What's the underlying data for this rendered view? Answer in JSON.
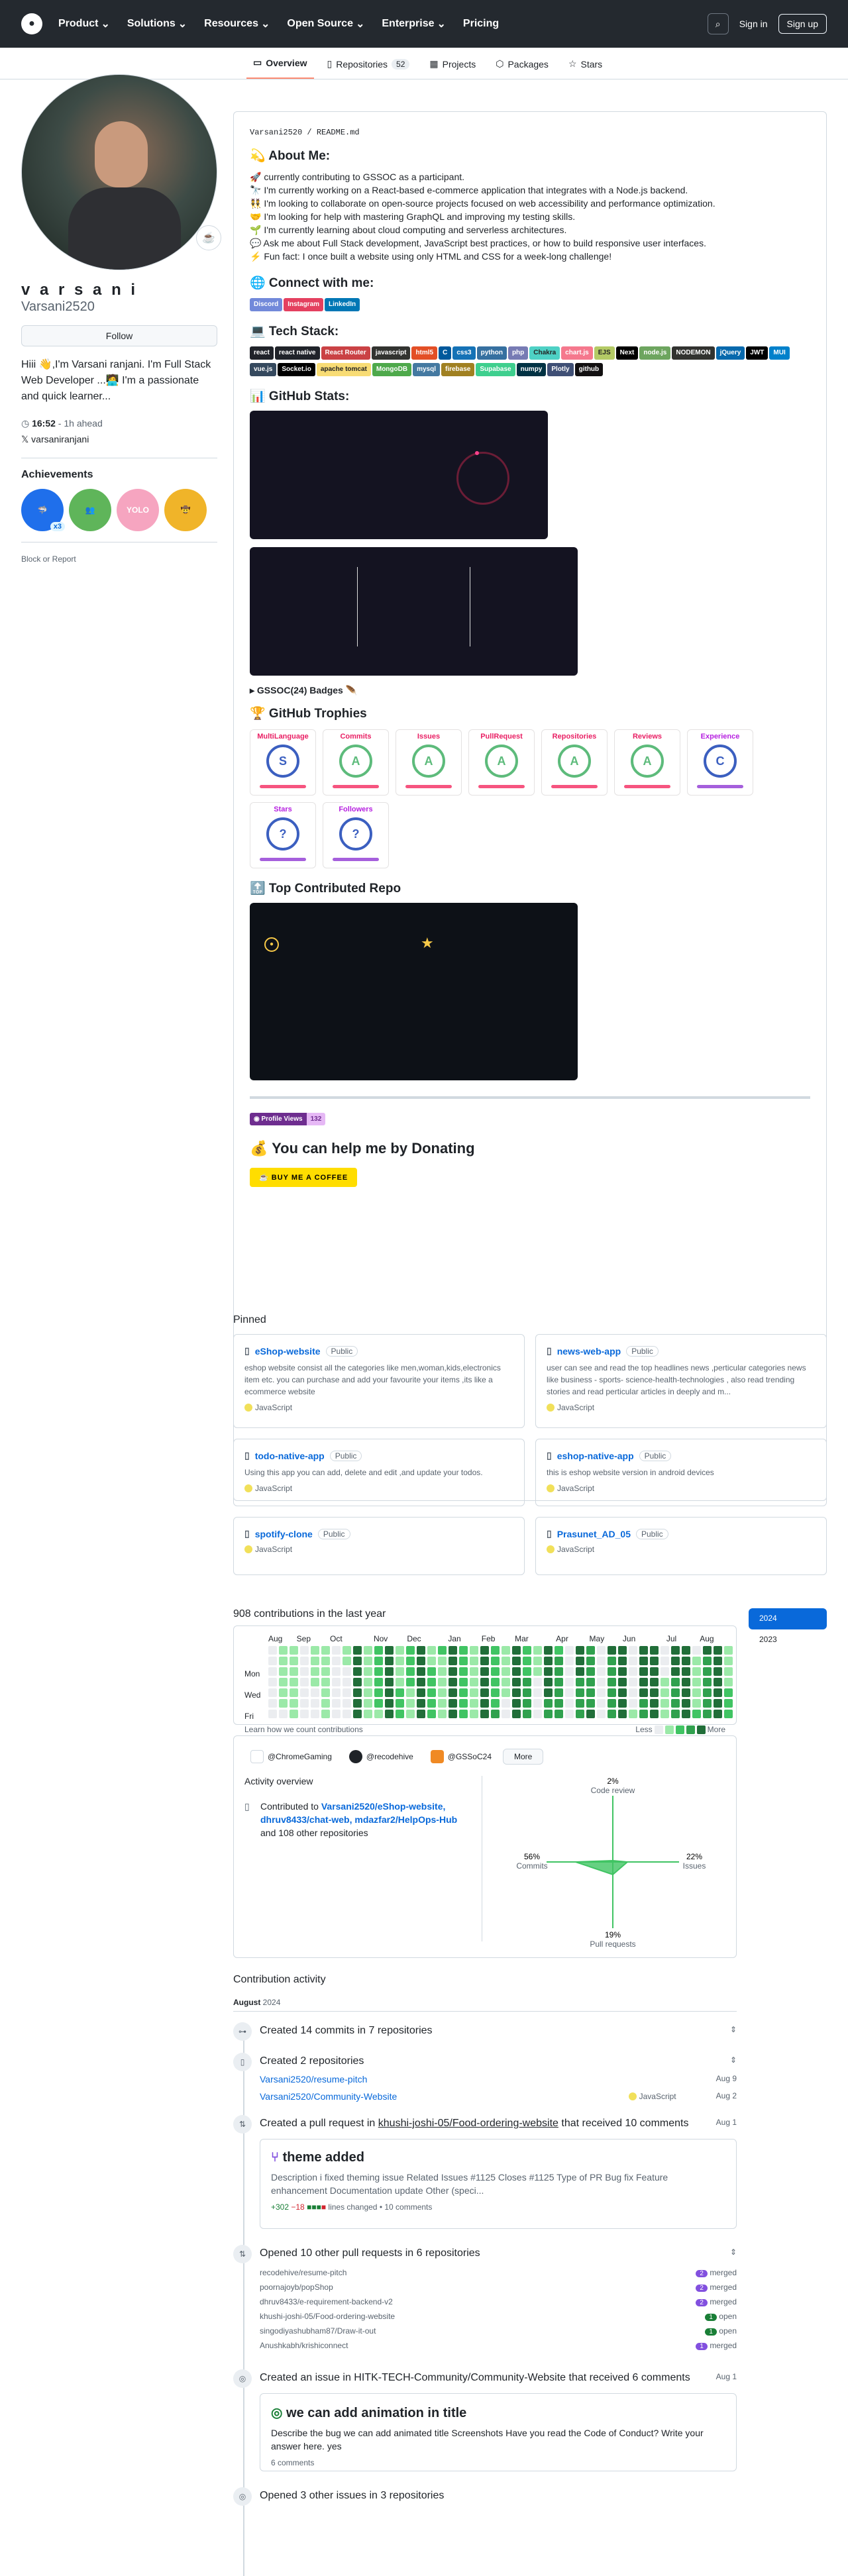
{
  "header": {
    "nav": [
      "Product",
      "Solutions",
      "Resources",
      "Open Source",
      "Enterprise",
      "Pricing"
    ],
    "signin": "Sign in",
    "signup": "Sign up"
  },
  "tabs": [
    {
      "label": "Overview"
    },
    {
      "label": "Repositories",
      "count": "52"
    },
    {
      "label": "Projects"
    },
    {
      "label": "Packages"
    },
    {
      "label": "Stars"
    }
  ],
  "profile": {
    "name": "v a r s a n i",
    "login": "Varsani2520",
    "follow": "Follow",
    "bio": "Hiii 👋,I'm Varsani ranjani. I'm Full Stack Web Developer ...🧑‍💻 I'm a passionate and quick learner...",
    "time": "16:52",
    "ahead": " - 1h ahead",
    "x": "varsaniranjani",
    "ach_title": "Achievements",
    "ach_count": "x3",
    "report": "Block or Report"
  },
  "readme": {
    "path": "Varsani2520 / README.md",
    "about": "💫 About Me:",
    "lines": [
      "🚀 currently contributing to GSSOC as a participant.",
      "🔭 I'm currently working on a React-based e-commerce application that integrates with a Node.js backend.",
      "👯 I'm looking to collaborate on open-source projects focused on web accessibility and performance optimization.",
      "🤝 I'm looking for help with mastering GraphQL and improving my testing skills.",
      "🌱 I'm currently learning about cloud computing and serverless architectures.",
      "💬 Ask me about Full Stack development, JavaScript best practices, or how to build responsive user interfaces.",
      "⚡ Fun fact: I once built a website using only HTML and CSS for a week-long challenge!"
    ],
    "connect": "🌐 Connect with me:",
    "socials": [
      {
        "t": "Discord",
        "c": "#7289da"
      },
      {
        "t": "Instagram",
        "c": "#e4405f"
      },
      {
        "t": "LinkedIn",
        "c": "#0077b5"
      }
    ],
    "tech": "💻 Tech Stack:",
    "stack": [
      {
        "t": "react",
        "c": "#20232a"
      },
      {
        "t": "react native",
        "c": "#20232a"
      },
      {
        "t": "React Router",
        "c": "#ca4245"
      },
      {
        "t": "javascript",
        "c": "#323330"
      },
      {
        "t": "html5",
        "c": "#e34f26"
      },
      {
        "t": "C",
        "c": "#00599c"
      },
      {
        "t": "css3",
        "c": "#1572b6"
      },
      {
        "t": "python",
        "c": "#3670a0"
      },
      {
        "t": "php",
        "c": "#777bb4"
      },
      {
        "t": "Chakra",
        "c": "#4ed1c5"
      },
      {
        "t": "chart.js",
        "c": "#f5788d"
      },
      {
        "t": "EJS",
        "c": "#b4ca65"
      },
      {
        "t": "Next",
        "c": "#000000"
      },
      {
        "t": "node.js",
        "c": "#6da55f"
      },
      {
        "t": "NODEMON",
        "c": "#323330"
      },
      {
        "t": "jQuery",
        "c": "#0769ad"
      },
      {
        "t": "JWT",
        "c": "#000000"
      },
      {
        "t": "MUI",
        "c": "#0081cb"
      },
      {
        "t": "vue.js",
        "c": "#35495e"
      },
      {
        "t": "Socket.io",
        "c": "#000000"
      },
      {
        "t": "apache tomcat",
        "c": "#f8dc75"
      },
      {
        "t": "MongoDB",
        "c": "#4ea94b"
      },
      {
        "t": "mysql",
        "c": "#4479a1"
      },
      {
        "t": "firebase",
        "c": "#a08021"
      },
      {
        "t": "Supabase",
        "c": "#3ecf8e"
      },
      {
        "t": "numpy",
        "c": "#013243"
      },
      {
        "t": "Plotly",
        "c": "#3f4f75"
      },
      {
        "t": "github",
        "c": "#121011"
      }
    ],
    "stats": "📊 GitHub Stats:",
    "gssoc": "▸ GSSOC(24) Badges 🪶",
    "trophies_title": "🏆 GitHub Trophies",
    "trophies": [
      {
        "t": "MultiLanguage",
        "g": "S"
      },
      {
        "t": "Commits",
        "g": "A"
      },
      {
        "t": "Issues",
        "g": "A"
      },
      {
        "t": "PullRequest",
        "g": "A"
      },
      {
        "t": "Repositories",
        "g": "A"
      },
      {
        "t": "Reviews",
        "g": "A"
      },
      {
        "t": "Experience",
        "g": "C"
      },
      {
        "t": "Stars",
        "g": "?"
      },
      {
        "t": "Followers",
        "g": "?"
      }
    ],
    "top_repo": "🔝 Top Contributed Repo",
    "views_label": "Profile Views",
    "views": "132",
    "donate": "💰 You can help me by Donating",
    "coffee": "☕ BUY ME A COFFEE"
  },
  "pinned": {
    "title": "Pinned",
    "public": "Public",
    "repos": [
      {
        "name": "eShop-website",
        "desc": "eshop website consist all the categories like men,woman,kids,electronics item etc. you can purchase and add your favourite your items ,its like a ecommerce website",
        "lang": "JavaScript"
      },
      {
        "name": "news-web-app",
        "desc": "user can see and read the top headlines news ,perticular categories news like business - sports- science-health-technologies , also read trending stories and read perticular articles in deeply and m...",
        "lang": "JavaScript"
      },
      {
        "name": "todo-native-app",
        "desc": "Using this app you can add, delete and edit ,and update your todos.",
        "lang": "JavaScript"
      },
      {
        "name": "eshop-native-app",
        "desc": "this is eshop website version in android devices",
        "lang": "JavaScript"
      },
      {
        "name": "spotify-clone",
        "desc": "",
        "lang": "JavaScript"
      },
      {
        "name": "Prasunet_AD_05",
        "desc": "",
        "lang": "JavaScript"
      }
    ]
  },
  "contrib": {
    "title": "908 contributions in the last year",
    "months": [
      "Aug",
      "Sep",
      "Oct",
      "Nov",
      "Dec",
      "Jan",
      "Feb",
      "Mar",
      "Apr",
      "May",
      "Jun",
      "Jul",
      "Aug"
    ],
    "days": [
      "Mon",
      "Wed",
      "Fri"
    ],
    "learn": "Learn how we count contributions",
    "less": "Less",
    "more": "More",
    "years": [
      "2024",
      "2023"
    ]
  },
  "overview": {
    "orgs": [
      "@ChromeGaming",
      "@recodehive",
      "@GSSoC24"
    ],
    "more": "More",
    "title": "Activity overview",
    "contributed": "Contributed to",
    "repos": "Varsani2520/eShop-website, dhruv8433/chat-web, mdazfar2/HelpOps-Hub",
    "others": "and 108 other repositories",
    "radar": {
      "code_review": "2%",
      "commits": "56%",
      "issues": "22%",
      "pull_requests": "19%",
      "l_code": "Code review",
      "l_commits": "Commits",
      "l_issues": "Issues",
      "l_prs": "Pull requests"
    }
  },
  "activity": {
    "title": "Contribution activity",
    "month": "August",
    "year": "2024",
    "commits": "Created 14 commits in 7 repositories",
    "repos": "Created 2 repositories",
    "r1": "Varsani2520/resume-pitch",
    "r1d": "Aug 9",
    "r2": "Varsani2520/Community-Website",
    "r2l": "JavaScript",
    "r2d": "Aug 2",
    "pr_pre": "Created a pull request in ",
    "pr_repo": "khushi-joshi-05/Food-ordering-website",
    "pr_post": " that received 10 comments",
    "pr_date": "Aug 1",
    "pr_title": "theme added",
    "pr_desc": "Description i fixed theming issue Related Issues #1125 Closes #1125 Type of PR Bug fix Feature enhancement Documentation update Other (speci...",
    "pr_add": "+302",
    "pr_del": "−18",
    "pr_lines": "lines changed",
    "pr_comments": "• 10 comments",
    "opened": "Opened 10 other pull requests in 6 repositories",
    "prs": [
      {
        "r": "recodehive/resume-pitch",
        "n": "2",
        "s": "merged"
      },
      {
        "r": "poornajoyb/popShop",
        "n": "2",
        "s": "merged"
      },
      {
        "r": "dhruv8433/e-requirement-backend-v2",
        "n": "2",
        "s": "merged"
      },
      {
        "r": "khushi-joshi-05/Food-ordering-website",
        "n": "1",
        "s": "open"
      },
      {
        "r": "singodiyashubham87/Draw-it-out",
        "n": "1",
        "s": "open"
      },
      {
        "r": "Anushkabh/krishiconnect",
        "n": "1",
        "s": "merged"
      }
    ],
    "issue": "Created an issue in HITK-TECH-Community/Community-Website that received 6 comments",
    "issue_date": "Aug 1",
    "issue_title": "we can add animation in title",
    "issue_desc": "Describe the bug we can add animated title Screenshots Have you read the Code of Conduct? Write your answer here. yes",
    "issue_comments": "6 comments",
    "last": "Opened 3 other issues in 3 repositories"
  }
}
